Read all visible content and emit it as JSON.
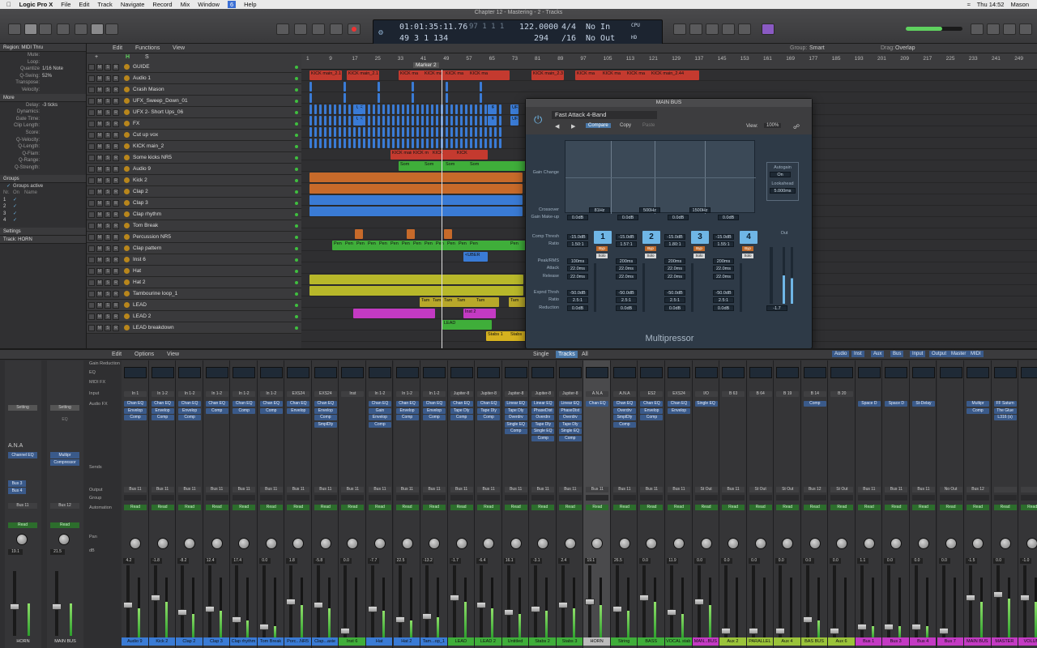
{
  "menubar": {
    "apple": "",
    "app": "Logic Pro X",
    "items": [
      "File",
      "Edit",
      "Track",
      "Navigate",
      "Record",
      "Mix",
      "Window",
      "6",
      "Help"
    ],
    "clock": "Thu 14:52",
    "user": "Mason"
  },
  "window_title": "Chapter 12 - Mastering - 2 - Tracks",
  "lcd": {
    "time": "01:01:35:11.76",
    "bars": "49 3 1 134",
    "bars_top": "97 1 1 1",
    "tempo": "122.0000",
    "tempo2": "294",
    "sig": "4/4",
    "div": "/16",
    "in": "No In",
    "out": "No Out",
    "cpu": "CPU",
    "hd": "HD"
  },
  "inspector": {
    "region_header": "Region: MIDI Thru",
    "rows": [
      [
        "Mute:",
        ""
      ],
      [
        "Loop:",
        ""
      ],
      [
        "Quantize",
        "1/16 Note"
      ],
      [
        "Q-Swing:",
        "52%"
      ],
      [
        "Transpose:",
        ""
      ],
      [
        "Velocity:",
        ""
      ]
    ],
    "more_header": "More",
    "more_rows": [
      [
        "Delay:",
        "-3 ticks"
      ],
      [
        "Dynamics:",
        ""
      ],
      [
        "Gate Time:",
        ""
      ],
      [
        "Clip Length:",
        ""
      ],
      [
        "Score:",
        ""
      ],
      [
        "Q-Velocity:",
        ""
      ],
      [
        "Q-Length:",
        ""
      ],
      [
        "Q-Flam:",
        ""
      ],
      [
        "Q-Range:",
        ""
      ],
      [
        "Q-Strength:",
        ""
      ]
    ],
    "groups_header": "Groups",
    "groups_active": "Groups active",
    "groups_cols": [
      "Nr.",
      "On",
      "Name"
    ],
    "groups": [
      "1",
      "2",
      "3",
      "4"
    ],
    "settings": "Settings",
    "track": "Track:  HORN"
  },
  "trackbar": {
    "edit": "Edit",
    "functions": "Functions",
    "view": "View",
    "group_label": "Group:",
    "group_val": "Smart",
    "drag_label": "Drag:",
    "drag_val": "Overlap"
  },
  "ruler": {
    "marks": [
      "1",
      "9",
      "17",
      "25",
      "33",
      "41",
      "49",
      "57",
      "65",
      "73",
      "81",
      "89",
      "97",
      "105",
      "113",
      "121",
      "129",
      "137",
      "145",
      "153",
      "161",
      "169",
      "177",
      "185",
      "193",
      "201",
      "209",
      "217",
      "225",
      "233",
      "241",
      "249",
      "257"
    ],
    "marker": "Marker 2"
  },
  "tracks": [
    {
      "name": "GUIDE",
      "color": "#c43a2f"
    },
    {
      "name": "Audio 1",
      "color": "#3a7bd5"
    },
    {
      "name": "Crash Mason",
      "color": "#3a7bd5"
    },
    {
      "name": "UFX_Sweep_Down_01",
      "color": "#3a7bd5"
    },
    {
      "name": "UFX 2- Short Ups_06",
      "color": "#3a7bd5"
    },
    {
      "name": "FX",
      "color": "#3a7bd5"
    },
    {
      "name": "Cut up vox",
      "color": "#3a7bd5"
    },
    {
      "name": "KICK main_2",
      "color": "#c43a2f"
    },
    {
      "name": "Some kicks NR5",
      "color": "#3fae3a"
    },
    {
      "name": "Audio 9",
      "color": "#c76a2a"
    },
    {
      "name": "Kick 2",
      "color": "#c76a2a"
    },
    {
      "name": "Clap 2",
      "color": "#3a7bd5"
    },
    {
      "name": "Clap 3",
      "color": "#3a7bd5"
    },
    {
      "name": "Clap rhythm",
      "color": "#3a7bd5"
    },
    {
      "name": "Tom Break",
      "color": "#c76a2a"
    },
    {
      "name": "Percussion NR5",
      "color": "#3fae3a"
    },
    {
      "name": "Clap pattern",
      "color": "#3a7bd5"
    },
    {
      "name": "Inst 6",
      "color": "#3a7bd5"
    },
    {
      "name": "Hat",
      "color": "#b8b82a"
    },
    {
      "name": "Hat 2",
      "color": "#b8b82a"
    },
    {
      "name": "Tambourine loop_1",
      "color": "#b8a82a"
    },
    {
      "name": "LEAD",
      "color": "#c33ac3"
    },
    {
      "name": "LEAD 2",
      "color": "#3fae3a"
    },
    {
      "name": "LEAD breakdown",
      "color": "#d6b21f"
    }
  ],
  "plugin": {
    "title": "MAIN BUS",
    "preset": "Fast Attack 4-Band",
    "compare": "Compare",
    "copy": "Copy",
    "paste": "Paste",
    "view_label": "View:",
    "view": "100%",
    "name": "Multipressor",
    "gain_change": "Gain Change",
    "crossover": "Crossover",
    "gain_makeup": "Gain Make-up",
    "xover": [
      "81Hz",
      "500Hz",
      "1500Hz"
    ],
    "makeups": [
      "0.0dB",
      "0.0dB",
      "0.0dB",
      "0.0dB"
    ],
    "autogain": "Autogain",
    "autogain_val": "On",
    "lookahead": "Lookahead",
    "lookahead_val": "5.000ms",
    "labels": [
      "Comp Thresh",
      "Ratio",
      "Peak/RMS",
      "Attack",
      "Release",
      "Expnd Thrsh",
      "Ratio",
      "Reduction"
    ],
    "bands": [
      "1",
      "2",
      "3",
      "4"
    ],
    "thresh": [
      "-15.0dB",
      "-15.0dB",
      "-15.0dB",
      "-15.0dB"
    ],
    "ratio": [
      "1.50:1",
      "1.57:1",
      "1.80:1",
      "1.55:1"
    ],
    "peak": [
      "100ms",
      "200ms",
      "200ms",
      "200ms"
    ],
    "attack": [
      "22.0ms",
      "22.0ms",
      "22.0ms",
      "22.0ms"
    ],
    "release": [
      "22.0ms",
      "22.0ms",
      "22.0ms",
      "22.0ms"
    ],
    "exp": [
      "-50.0dB",
      "-50.0dB",
      "-50.0dB",
      "-50.0dB"
    ],
    "exr": [
      "2.5:1",
      "2.5:1",
      "2.5:1",
      "2.5:1"
    ],
    "red": [
      "0.0dB",
      "0.0dB",
      "0.0dB",
      "0.0dB"
    ],
    "out": "Out",
    "out_val": "-1.7",
    "byp": "Byp",
    "solo": "Solo"
  },
  "mixbar": {
    "edit": "Edit",
    "options": "Options",
    "view": "View",
    "single": "Single",
    "tracks": "Tracks",
    "all": "All",
    "filters": [
      "Audio",
      "Inst",
      "Aux",
      "Bus",
      "Input",
      "Output",
      "Master",
      "MIDI"
    ]
  },
  "mixrows": [
    "Gain Reduction",
    "EQ",
    "MIDI FX",
    "Input",
    "Audio FX",
    "Sends",
    "Output",
    "Group",
    "Automation",
    "Pan",
    "dB"
  ],
  "strips": [
    {
      "name": "Audio 9",
      "color": "#3a7bd5",
      "input": "In 1",
      "fx": [
        "Chan EQ",
        "Envelop",
        "Comp"
      ],
      "out": "Bus 11",
      "db": "4.2",
      "level": 0.5
    },
    {
      "name": "Kick 2",
      "color": "#3a7bd5",
      "input": "In 1-2",
      "fx": [
        "Chan EQ",
        "Envelop",
        "Comp"
      ],
      "out": "Bus 11",
      "db": "-1.8",
      "level": 0.6
    },
    {
      "name": "Clap 2",
      "color": "#3a7bd5",
      "input": "In 1-2",
      "fx": [
        "Chan EQ",
        "Envelop",
        "Comp"
      ],
      "out": "Bus 11",
      "db": "-8.2",
      "level": 0.4
    },
    {
      "name": "Clap 3",
      "color": "#3a7bd5",
      "input": "In 1-2",
      "fx": [
        "Chan EQ",
        "Comp"
      ],
      "out": "Bus 11",
      "db": "12.4",
      "level": 0.45
    },
    {
      "name": "Clap rhythm",
      "color": "#3a7bd5",
      "input": "In 1-2",
      "fx": [
        "Chan EQ",
        "Comp"
      ],
      "out": "Bus 11",
      "db": "17.4",
      "level": 0.3
    },
    {
      "name": "Tom Break",
      "color": "#3a7bd5",
      "input": "In 1-2",
      "fx": [
        "Chan EQ",
        "Comp"
      ],
      "out": "Bus 11",
      "db": "0.0",
      "level": 0.2
    },
    {
      "name": "Porc...NR5",
      "color": "#3a7bd5",
      "input": "EXS24",
      "fx": [
        "Chan EQ",
        "Envelop"
      ],
      "out": "Bus 11",
      "db": "1.8",
      "level": 0.55
    },
    {
      "name": "Clap...axie",
      "color": "#3a7bd5",
      "input": "EXS24",
      "fx": [
        "Chan EQ",
        "Envelop",
        "Comp",
        "SmplDly"
      ],
      "out": "Bus 11",
      "db": "-5.8",
      "level": 0.5
    },
    {
      "name": "Inst 6",
      "color": "#3fae3a",
      "input": "Inst",
      "fx": [],
      "out": "Bus 11",
      "db": "0.0",
      "level": 0.0
    },
    {
      "name": "Hat",
      "color": "#3a7bd5",
      "input": "In 1-2",
      "fx": [
        "Chan EQ",
        "Gain",
        "Envelop",
        "Comp"
      ],
      "out": "Bus 11",
      "db": "-7.7",
      "level": 0.45
    },
    {
      "name": "Hat 2",
      "color": "#3a7bd5",
      "input": "In 1-2",
      "fx": [
        "Chan EQ",
        "Envelop",
        "Comp"
      ],
      "out": "Bus 11",
      "db": "22.5",
      "level": 0.3
    },
    {
      "name": "Tam...op_1",
      "color": "#3a7bd5",
      "input": "In 1-2",
      "fx": [
        "Chan EQ",
        "Envelop",
        "Comp"
      ],
      "out": "Bus 11",
      "db": "-13.2",
      "level": 0.35
    },
    {
      "name": "LEAD",
      "color": "#3fae3a",
      "input": "Jupiter-8",
      "fx": [
        "Chan EQ",
        "Tape Dly",
        "Comp"
      ],
      "out": "Bus 11",
      "db": "-1.7",
      "level": 0.6
    },
    {
      "name": "LEAD 2",
      "color": "#3fae3a",
      "input": "Jupiter-8",
      "fx": [
        "Chan EQ",
        "Tape Dly",
        "Comp"
      ],
      "out": "Bus 11",
      "db": "-6.4",
      "level": 0.5
    },
    {
      "name": "Untitled",
      "color": "#3fae3a",
      "input": "Jupiter-8",
      "fx": [
        "Linear EQ",
        "Tape Dly",
        "Overdrv",
        "Single EQ",
        "Comp"
      ],
      "out": "Bus 11",
      "db": "16.1",
      "level": 0.4
    },
    {
      "name": "Stabs 2",
      "color": "#3fae3a",
      "input": "Jupiter-8",
      "fx": [
        "Linear EQ",
        "PhaseDist",
        "Overdrv",
        "Tape Dly",
        "Single EQ",
        "Comp"
      ],
      "out": "Bus 11",
      "db": "-3.1",
      "level": 0.45
    },
    {
      "name": "Stabs 3",
      "color": "#3fae3a",
      "input": "Jupiter-8",
      "fx": [
        "Linear EQ",
        "PhaseDist",
        "Overdrv",
        "Tape Dly",
        "Single EQ",
        "Comp"
      ],
      "out": "Bus 11",
      "db": "2.4",
      "level": 0.5
    },
    {
      "name": "HORN",
      "color": "#bcbcbc",
      "input": "A.N.A",
      "fx": [
        "Chan EQ"
      ],
      "out": "Bus 11",
      "db": "19.1",
      "level": 0.55,
      "selected": true
    },
    {
      "name": "String",
      "color": "#3fae3a",
      "input": "A.N.A",
      "fx": [
        "Chan EQ",
        "Overdrv",
        "SmplDly",
        "Comp"
      ],
      "out": "Bus 11",
      "db": "26.5",
      "level": 0.45
    },
    {
      "name": "BASS",
      "color": "#3fae3a",
      "input": "ES2",
      "fx": [
        "Chan EQ",
        "Envelop",
        "Comp"
      ],
      "out": "Bus 11",
      "db": "0.0",
      "level": 0.6
    },
    {
      "name": "VOCAL stab",
      "color": "#3fae3a",
      "input": "EXS24",
      "fx": [
        "Chan EQ",
        "Envelop"
      ],
      "out": "Bus 11",
      "db": "11.9",
      "level": 0.4
    },
    {
      "name": "MAN...BUS",
      "color": "#c33ac3",
      "input": "I/O",
      "fx": [
        "Single EQ"
      ],
      "out": "St Out",
      "db": "0.0",
      "level": 0.55
    },
    {
      "name": "Aux 2",
      "color": "#9ac33a",
      "input": "B 63",
      "fx": [],
      "out": "Bus 11",
      "db": "0.0",
      "level": 0.0
    },
    {
      "name": "PARALLEL",
      "color": "#9ac33a",
      "input": "B 64",
      "fx": [],
      "out": "St Out",
      "db": "0.0",
      "level": 0.0
    },
    {
      "name": "Aux 4",
      "color": "#9ac33a",
      "input": "B 19",
      "fx": [],
      "out": "St Out",
      "db": "0.0",
      "level": 0.0
    },
    {
      "name": "BAS BUS",
      "color": "#9ac33a",
      "input": "B 14",
      "fx": [
        "Comp"
      ],
      "out": "Bus 12",
      "db": "0.0",
      "level": 0.3
    },
    {
      "name": "Aux 6",
      "color": "#9ac33a",
      "input": "B 20",
      "fx": [],
      "out": "St Out",
      "db": "0.0",
      "level": 0.0
    },
    {
      "name": "Bus 1",
      "color": "#c33ac3",
      "input": "",
      "fx": [
        "Space D"
      ],
      "out": "Bus 11",
      "db": "1.1",
      "level": 0.2
    },
    {
      "name": "Bus 3",
      "color": "#c33ac3",
      "input": "",
      "fx": [
        "Space D"
      ],
      "out": "Bus 11",
      "db": "0.0",
      "level": 0.2
    },
    {
      "name": "Bus 4",
      "color": "#c33ac3",
      "input": "",
      "fx": [
        "St-Delay"
      ],
      "out": "Bus 11",
      "db": "0.0",
      "level": 0.2
    },
    {
      "name": "Bus 7",
      "color": "#c33ac3",
      "input": "",
      "fx": [],
      "out": "No Out",
      "db": "0.0",
      "level": 0.0
    },
    {
      "name": "MAIN BUS",
      "color": "#c33ac3",
      "input": "",
      "fx": [
        "Multipr",
        "Comp"
      ],
      "out": "Bus 12",
      "db": "-1.5",
      "level": 0.6
    },
    {
      "name": "MASTER",
      "color": "#c33ac3",
      "input": "",
      "fx": [
        "FF Saturn",
        "The Glue",
        "L316 (s)"
      ],
      "out": "",
      "db": "0.0",
      "level": 0.65
    },
    {
      "name": "VOLUM",
      "color": "#c33ac3",
      "input": "",
      "fx": [],
      "out": "",
      "db": "-1.0",
      "level": 0.6
    }
  ],
  "left_strips": [
    {
      "name": "HORN",
      "input": "A.N.A",
      "fx": [
        "Channel EQ"
      ],
      "sends": [
        "Bus 3",
        "Bus 4"
      ],
      "out": "Bus 11",
      "db": "19.1",
      "setting": "Setting"
    },
    {
      "name": "MAIN BUS",
      "fx": [
        "Multipr",
        "Compressor"
      ],
      "out": "Bus 12",
      "db": "21.5",
      "setting": "Setting",
      "eq": "EQ"
    }
  ],
  "read": "Read"
}
